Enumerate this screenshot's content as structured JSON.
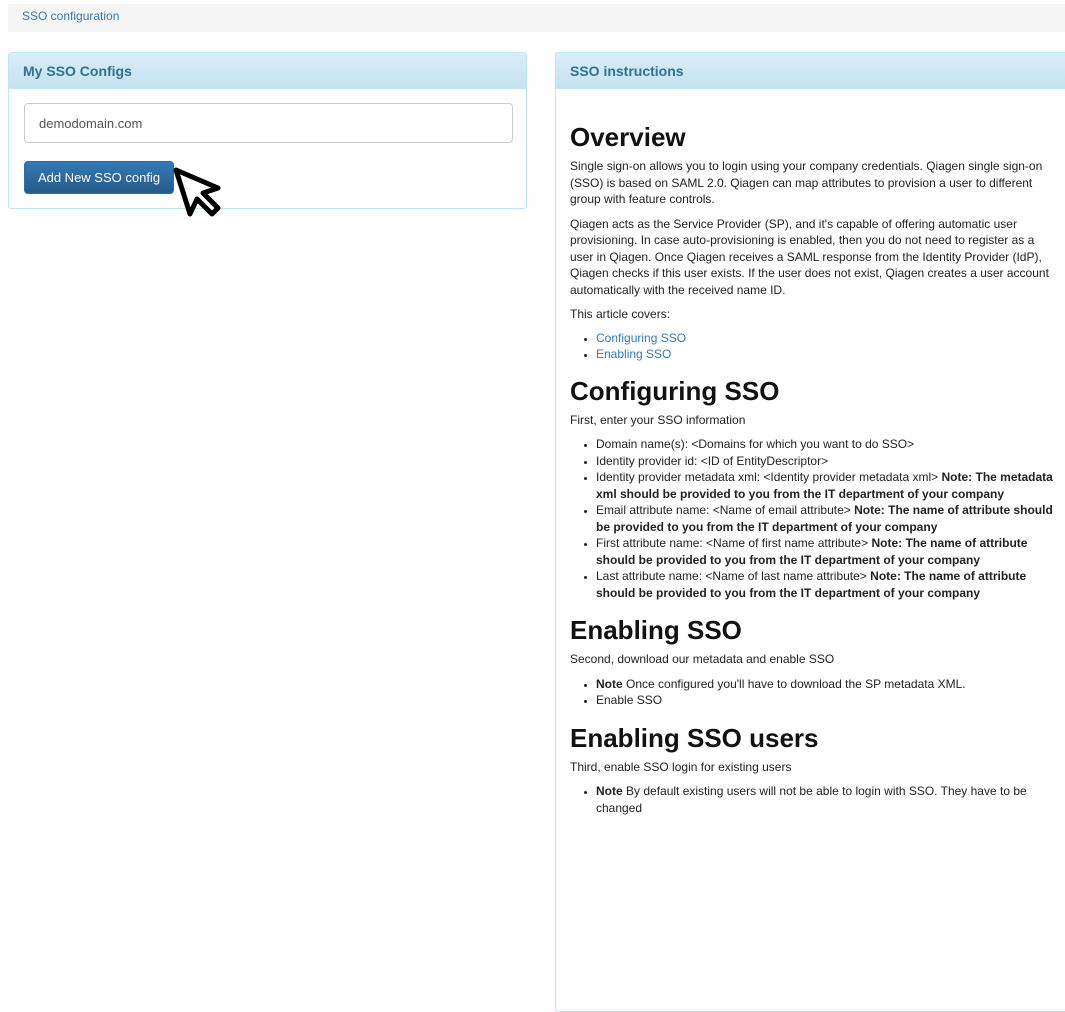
{
  "breadcrumb": {
    "label": "SSO configuration"
  },
  "configs_panel": {
    "title": "My SSO Configs",
    "domain_input_value": "demodomain.com",
    "add_button_label": "Add New SSO config"
  },
  "cursor": {
    "icon": "mouse-pointer-icon"
  },
  "instructions": {
    "title": "SSO instructions",
    "overview_heading": "Overview",
    "overview_p1": "Single sign-on allows you to login using your company credentials. Qiagen single sign-on (SSO) is based on SAML 2.0. Qiagen can map attributes to provision a user to different group with feature controls.",
    "overview_p2": "Qiagen acts as the Service Provider (SP), and it's capable of offering automatic user provisioning. In case auto-provisioning is enabled, then you do not need to register as a user in Qiagen. Once Qiagen receives a SAML response from the Identity Provider (IdP), Qiagen checks if this user exists. If the user does not exist, Qiagen creates a user account automatically with the received name ID.",
    "covers_label": "This article covers:",
    "toc": [
      "Configuring SSO",
      "Enabling SSO"
    ],
    "configuring_heading": "Configuring SSO",
    "configuring_intro": "First, enter your SSO information",
    "config_items": [
      {
        "text": "Domain name(s): <Domains for which you want to do SSO>",
        "note": ""
      },
      {
        "text": "Identity provider id: <ID of EntityDescriptor>",
        "note": ""
      },
      {
        "text": "Identity provider metadata xml: <Identity provider metadata xml> ",
        "note": "Note: The metadata xml should be provided to you from the IT department of your company"
      },
      {
        "text": "Email attribute name: <Name of email attribute> ",
        "note": "Note: The name of attribute should be provided to you from the IT department of your company"
      },
      {
        "text": "First attribute name: <Name of first name attribute> ",
        "note": "Note: The name of attribute should be provided to you from the IT department of your company"
      },
      {
        "text": "Last attribute name: <Name of last name attribute> ",
        "note": "Note: The name of attribute should be provided to you from the IT department of your company"
      }
    ],
    "enabling_heading": "Enabling SSO",
    "enabling_intro": "Second, download our metadata and enable SSO",
    "enabling_items": [
      {
        "note": "Note",
        "text": " Once configured you'll have to download the SP metadata XML."
      },
      {
        "note": "",
        "text": "Enable SSO"
      }
    ],
    "users_heading": "Enabling SSO users",
    "users_intro": "Third, enable SSO login for existing users",
    "users_items": [
      {
        "note": "Note",
        "text": " By default existing users will not be able to login with SSO. They have to be changed"
      }
    ]
  }
}
